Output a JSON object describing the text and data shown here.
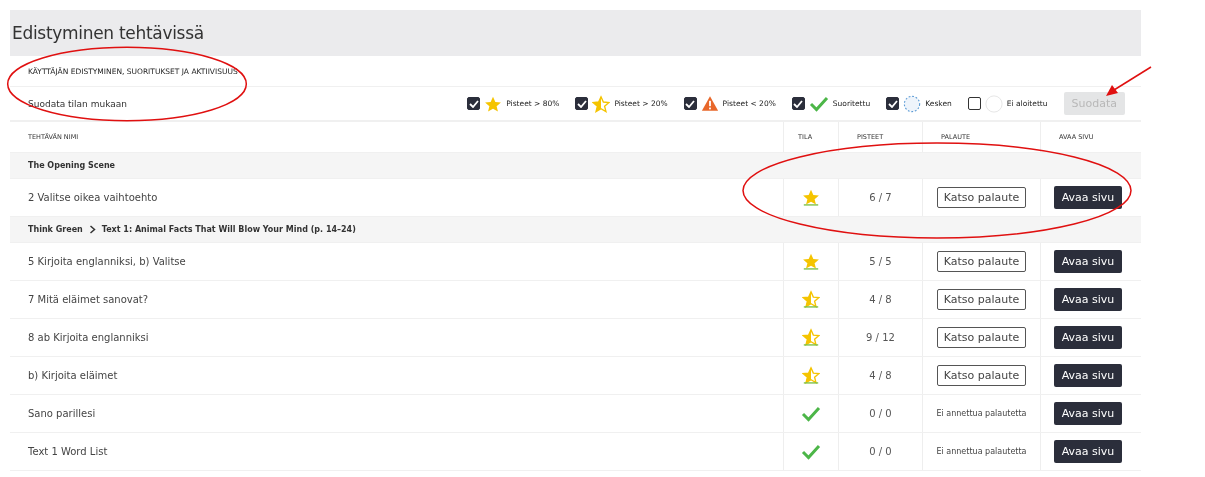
{
  "title": "Edistyminen tehtävissä",
  "subtitle": "KÄYTTÄJÄN EDISTYMINEN, SUORITUKSET JA AKTIIVISUUS",
  "filter": {
    "label": "Suodata tilan mukaan",
    "options": [
      {
        "kind": "star-full",
        "label": "Pisteet > 80%",
        "checked": true
      },
      {
        "kind": "star-half",
        "label": "Pisteet > 20%",
        "checked": true
      },
      {
        "kind": "warning",
        "label": "Pisteet < 20%",
        "checked": true
      },
      {
        "kind": "check",
        "label": "Suoritettu",
        "checked": true
      },
      {
        "kind": "progress",
        "label": "Kesken",
        "checked": true
      },
      {
        "kind": "empty",
        "label": "Ei aloitettu",
        "checked": false
      }
    ],
    "button": {
      "label": "Suodata",
      "disabled": true
    }
  },
  "table": {
    "columns": [
      "TEHTÄVÄN NIMI",
      "TILA",
      "PISTEET",
      "PALAUTE",
      "AVAA SIVU"
    ],
    "rows": [
      {
        "kind": "group",
        "crumbs": [
          "The Opening Scene"
        ]
      },
      {
        "kind": "task",
        "name": "2 Valitse oikea vaihtoehto",
        "status": {
          "kind": "star-full"
        },
        "score": "6 / 7",
        "feedback": {
          "kind": "button",
          "label": "Katso palaute"
        },
        "open": "Avaa sivu"
      },
      {
        "kind": "group",
        "crumbs": [
          "Think Green",
          "Text 1: Animal Facts That Will Blow Your Mind (p. 14–24)"
        ]
      },
      {
        "kind": "task",
        "name": "5 Kirjoita englanniksi, b) Valitse",
        "status": {
          "kind": "star-full"
        },
        "score": "5 / 5",
        "feedback": {
          "kind": "button",
          "label": "Katso palaute"
        },
        "open": "Avaa sivu"
      },
      {
        "kind": "task",
        "name": "7 Mitä eläimet sanovat?",
        "status": {
          "kind": "star-half"
        },
        "score": "4 / 8",
        "feedback": {
          "kind": "button",
          "label": "Katso palaute"
        },
        "open": "Avaa sivu"
      },
      {
        "kind": "task",
        "name": "8 ab Kirjoita englanniksi",
        "status": {
          "kind": "star-half"
        },
        "score": "9 / 12",
        "feedback": {
          "kind": "button",
          "label": "Katso palaute"
        },
        "open": "Avaa sivu"
      },
      {
        "kind": "task",
        "name": "b) Kirjoita eläimet",
        "status": {
          "kind": "star-half"
        },
        "score": "4 / 8",
        "feedback": {
          "kind": "button",
          "label": "Katso palaute"
        },
        "open": "Avaa sivu"
      },
      {
        "kind": "task",
        "name": "Sano parillesi",
        "status": {
          "kind": "check"
        },
        "score": "0 / 0",
        "feedback": {
          "kind": "text",
          "label": "Ei annettua palautetta"
        },
        "open": "Avaa sivu"
      },
      {
        "kind": "task",
        "name": "Text 1 Word List",
        "status": {
          "kind": "check"
        },
        "score": "0 / 0",
        "feedback": {
          "kind": "text",
          "label": "Ei annettua palautetta"
        },
        "open": "Avaa sivu"
      }
    ]
  },
  "annotations": [
    {
      "kind": "ellipse"
    },
    {
      "kind": "ellipse"
    },
    {
      "kind": "arrow"
    }
  ]
}
